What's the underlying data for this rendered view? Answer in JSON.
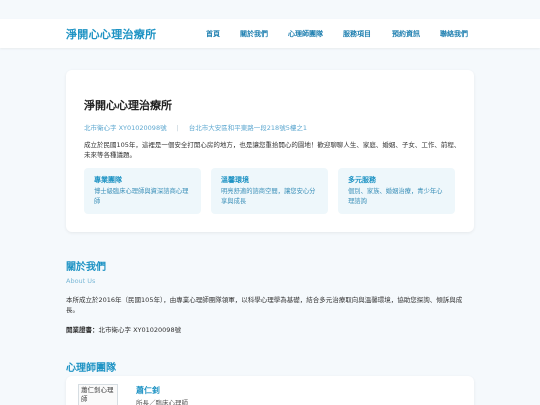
{
  "header": {
    "brand": "淨開心心理治療所",
    "nav": [
      "首頁",
      "關於我們",
      "心理師團隊",
      "服務項目",
      "預約資訊",
      "聯絡我們"
    ]
  },
  "hero": {
    "title": "淨開心心理治療所",
    "license": "北市衛心字 XY01020098號",
    "separator": "|",
    "address": "台北市大安區和平東路一段218號5樓之1",
    "intro": "成立於民國105年，這裡是一個安全打開心房的地方，也是讓您重拾開心的園地！歡迎聊聊人生、家庭、婚姻、子女、工作、前程、未來等各種議題。",
    "features": [
      {
        "title": "專業團隊",
        "text": "博士級臨床心理師與資深諮商心理師"
      },
      {
        "title": "溫馨環境",
        "text": "明亮舒適的諮商空間，讓您安心分享與成長"
      },
      {
        "title": "多元服務",
        "text": "個別、家族、婚姻治療，青少年心理諮詢"
      }
    ]
  },
  "about": {
    "title": "關於我們",
    "subtitle": "About Us",
    "text": "本所成立於2016年（民國105年），由專業心理師團隊領軍，以科學心理學為基礎，結合多元治療取向與溫馨環境，協助您探詢、傾訴與成長。",
    "license_label": "開業證書：",
    "license_value": "北市衛心字 XY01020098號"
  },
  "team": {
    "title": "心理師團隊",
    "members": [
      {
        "photo_alt": "蕭仁釗心理師",
        "name": "蕭仁釗",
        "role": "所長／臨床心理師"
      }
    ]
  },
  "colors": {
    "accent": "#1e93c4",
    "background": "#f5f9fc",
    "card_bg": "#eef7fb"
  }
}
